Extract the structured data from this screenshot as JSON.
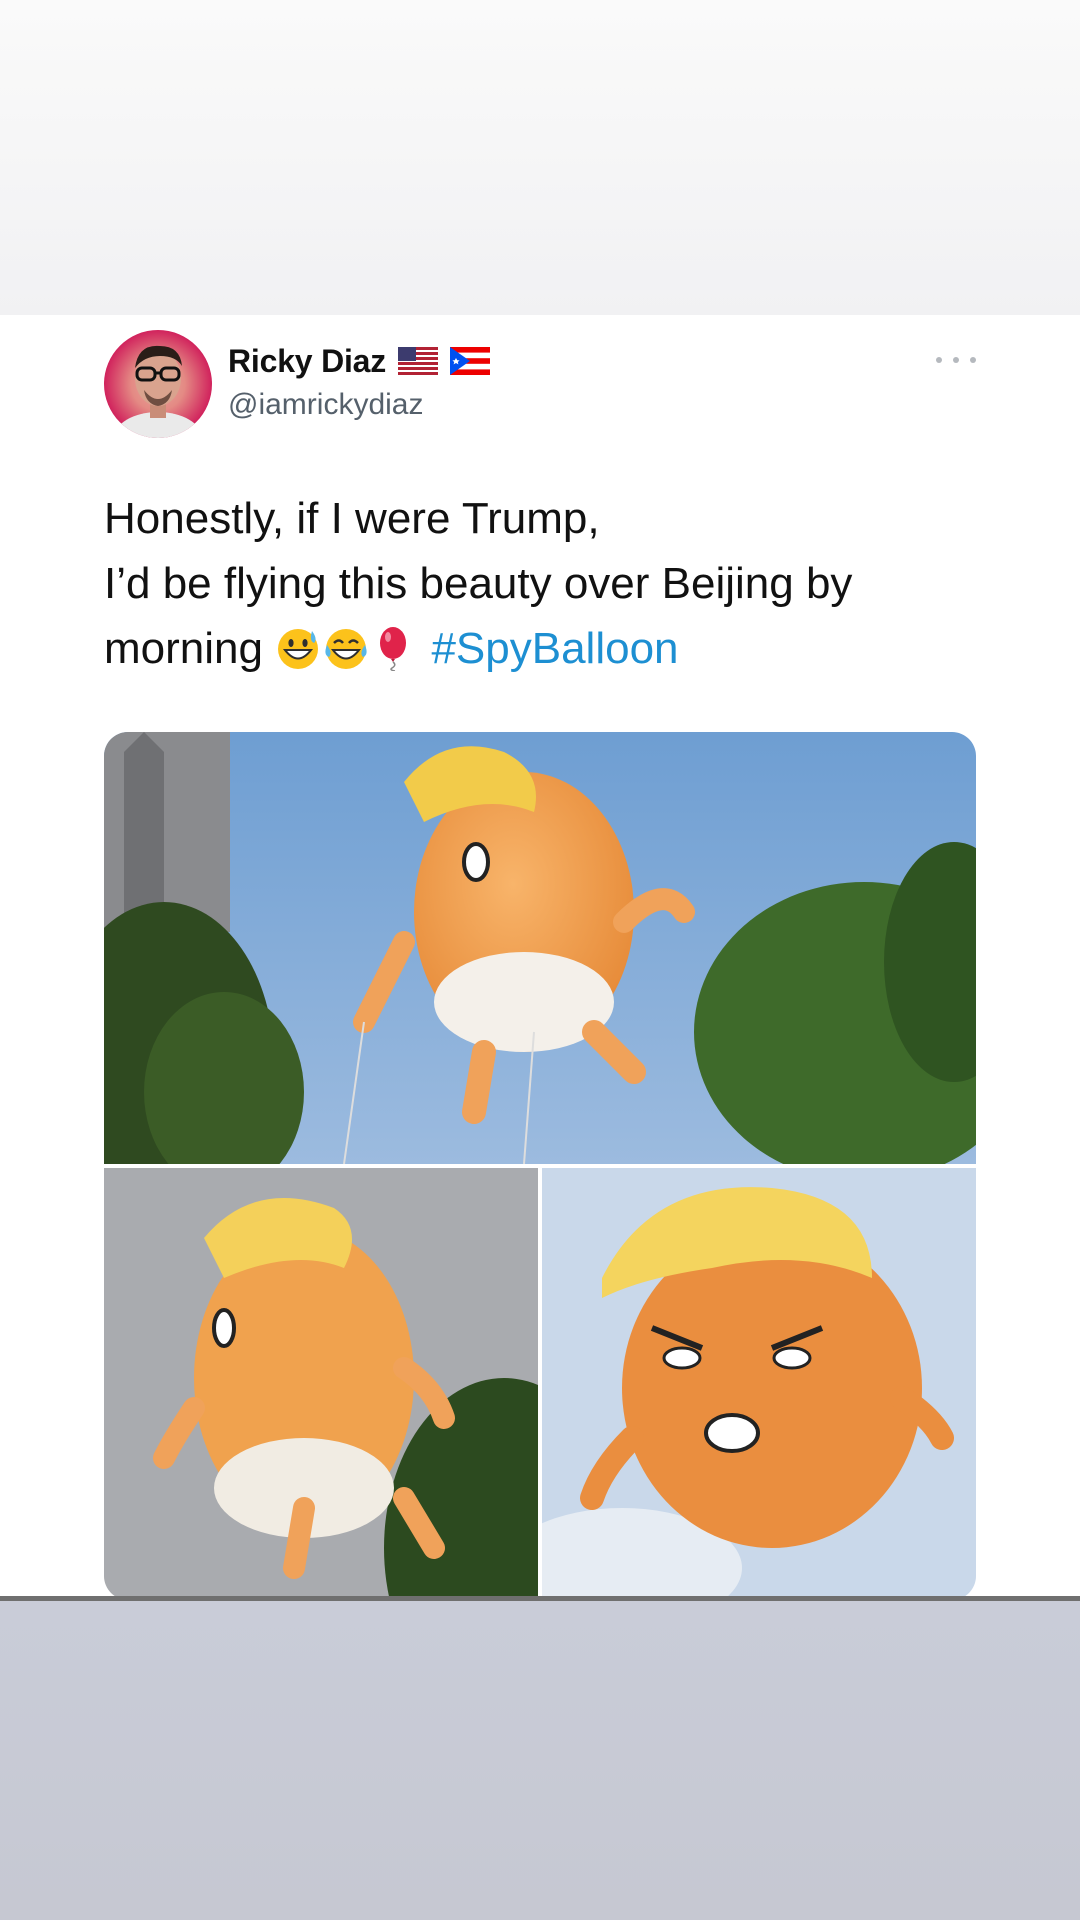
{
  "tweet": {
    "display_name": "Ricky Diaz",
    "handle": "@iamrickydiaz",
    "flags": [
      "us-flag-icon",
      "puerto-rico-flag-icon"
    ],
    "more_icon": "more-options-icon",
    "text_lines": [
      "Honestly, if I were Trump,",
      "I’d be flying this beauty over Beijing by",
      "morning"
    ],
    "emojis": [
      "grinning-sweat-emoji",
      "tears-of-joy-emoji",
      "balloon-emoji"
    ],
    "hashtag": "#SpyBalloon",
    "media": [
      {
        "icon": "baby-balloon-photo-sky-trees"
      },
      {
        "icon": "baby-balloon-photo-grey-sky"
      },
      {
        "icon": "baby-balloon-photo-closeup"
      }
    ]
  },
  "colors": {
    "hashtag": "#1d8fd2",
    "handle": "#55606b",
    "avatar_bg": "#d1245d",
    "bottom_band": "#c9ccd8"
  }
}
